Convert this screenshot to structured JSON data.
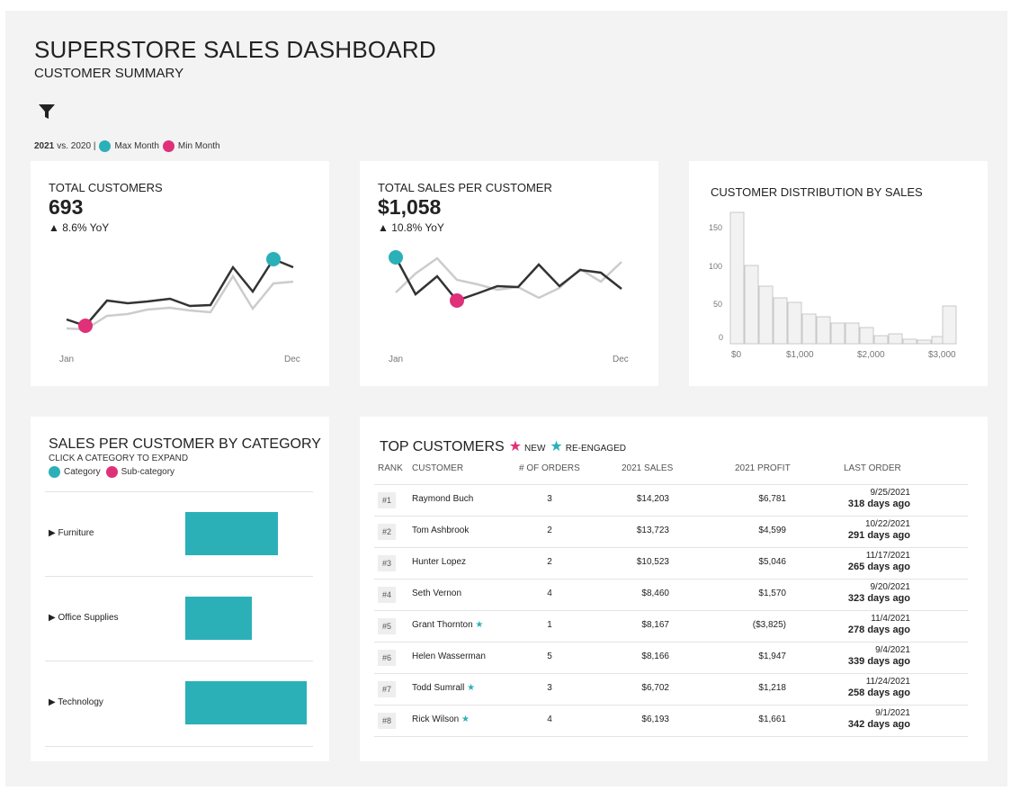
{
  "header": {
    "title": "SUPERSTORE SALES DASHBOARD",
    "subtitle": "CUSTOMER SUMMARY"
  },
  "legend": {
    "year_current": "2021",
    "vs_text": "vs. 2020 |",
    "max_label": "Max Month",
    "min_label": "Min Month",
    "max_color": "#2bb0b8",
    "min_color": "#e0307a"
  },
  "kpi_customers": {
    "label": "TOTAL CUSTOMERS",
    "value": "693",
    "yoy": "▲ 8.6% YoY",
    "x_start": "Jan",
    "x_end": "Dec"
  },
  "kpi_sales": {
    "label": "TOTAL SALES PER CUSTOMER",
    "value": "$1,058",
    "yoy": "▲ 10.8% YoY",
    "x_start": "Jan",
    "x_end": "Dec"
  },
  "distribution": {
    "title": "CUSTOMER DISTRIBUTION BY SALES",
    "y_ticks": [
      "150",
      "100",
      "50",
      "0"
    ],
    "x_ticks": [
      "$0",
      "$1,000",
      "$2,000",
      "$3,000"
    ]
  },
  "category": {
    "title": "SALES PER CUSTOMER BY CATEGORY",
    "hint": "CLICK A CATEGORY TO EXPAND",
    "legend_category": "Category",
    "legend_subcategory": "Sub-category",
    "rows": [
      {
        "name": "▶ Furniture",
        "value": 0.76
      },
      {
        "name": "▶ Office Supplies",
        "value": 0.55
      },
      {
        "name": "▶ Technology",
        "value": 1.0
      }
    ]
  },
  "top": {
    "title": "TOP CUSTOMERS",
    "new_label": "NEW",
    "reengaged_label": "RE-ENGAGED",
    "headers": {
      "rank": "RANK",
      "customer": "CUSTOMER",
      "orders": "# OF ORDERS",
      "sales": "2021 SALES",
      "profit": "2021 PROFIT",
      "last": "LAST ORDER"
    },
    "rows": [
      {
        "rank": "#1",
        "customer": "Raymond Buch",
        "orders": "3",
        "sales": "$14,203",
        "profit": "$6,781",
        "date": "9/25/2021",
        "ago": "318 days ago"
      },
      {
        "rank": "#2",
        "customer": "Tom Ashbrook",
        "orders": "2",
        "sales": "$13,723",
        "profit": "$4,599",
        "date": "10/22/2021",
        "ago": "291 days ago"
      },
      {
        "rank": "#3",
        "customer": "Hunter Lopez",
        "orders": "2",
        "sales": "$10,523",
        "profit": "$5,046",
        "date": "11/17/2021",
        "ago": "265 days ago"
      },
      {
        "rank": "#4",
        "customer": "Seth Vernon",
        "orders": "4",
        "sales": "$8,460",
        "profit": "$1,570",
        "date": "9/20/2021",
        "ago": "323 days ago"
      },
      {
        "rank": "#5",
        "customer": "Grant Thornton",
        "orders": "1",
        "sales": "$8,167",
        "profit": "($3,825)",
        "date": "11/4/2021",
        "ago": "278 days ago"
      },
      {
        "rank": "#6",
        "customer": "Helen Wasserman",
        "orders": "5",
        "sales": "$8,166",
        "profit": "$1,947",
        "date": "9/4/2021",
        "ago": "339 days ago"
      },
      {
        "rank": "#7",
        "customer": "Todd Sumrall",
        "orders": "3",
        "sales": "$6,702",
        "profit": "$1,218",
        "date": "11/24/2021",
        "ago": "258 days ago"
      },
      {
        "rank": "#8",
        "customer": "Rick Wilson",
        "orders": "4",
        "sales": "$6,193",
        "profit": "$1,661",
        "date": "9/1/2021",
        "ago": "342 days ago"
      }
    ]
  },
  "colors": {
    "teal": "#2bb0b8",
    "pink": "#e0307a",
    "line_current": "#333333",
    "line_prior": "#cccccc"
  }
}
